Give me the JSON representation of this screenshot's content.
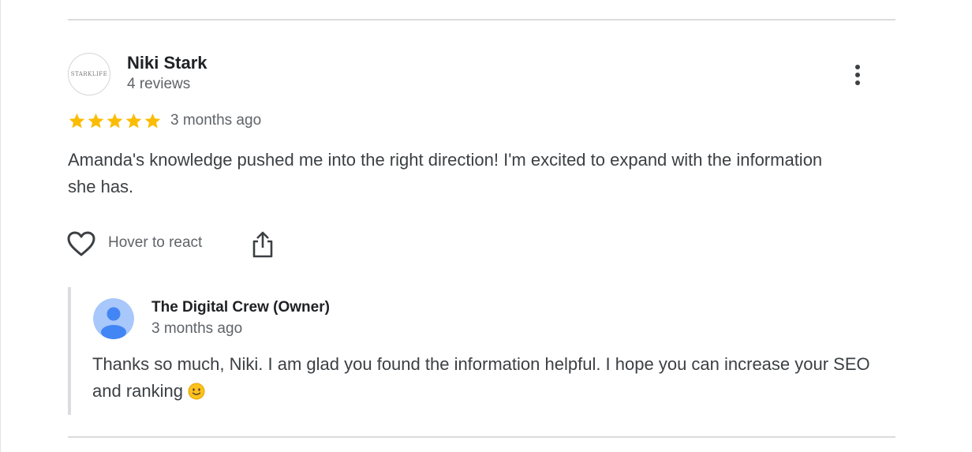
{
  "review": {
    "reviewer_name": "Niki Stark",
    "reviewer_reviews": "4 reviews",
    "avatar_logo_text": "STARKLIFE",
    "rating": 5,
    "rating_max": 5,
    "time": "3 months ago",
    "text": "Amanda's knowledge pushed me into the right direction! I'm excited to expand with the information she has."
  },
  "actions": {
    "react_label": "Hover to react"
  },
  "reply": {
    "owner_name": "The Digital Crew (Owner)",
    "time": "3 months ago",
    "text": "Thanks so much, Niki. I am glad you found the information helpful. I hope you can increase your SEO and ranking",
    "emoji": "slightly-smiling-face"
  },
  "colors": {
    "star": "#fbbc04",
    "owner_avatar_bg": "#a8c7fa",
    "owner_avatar_fg": "#4285f4",
    "text": "#3c4043",
    "muted": "#5f6368"
  },
  "icons": {
    "more": "more-vert-icon",
    "like": "heart-outline-icon",
    "share": "share-icon"
  }
}
